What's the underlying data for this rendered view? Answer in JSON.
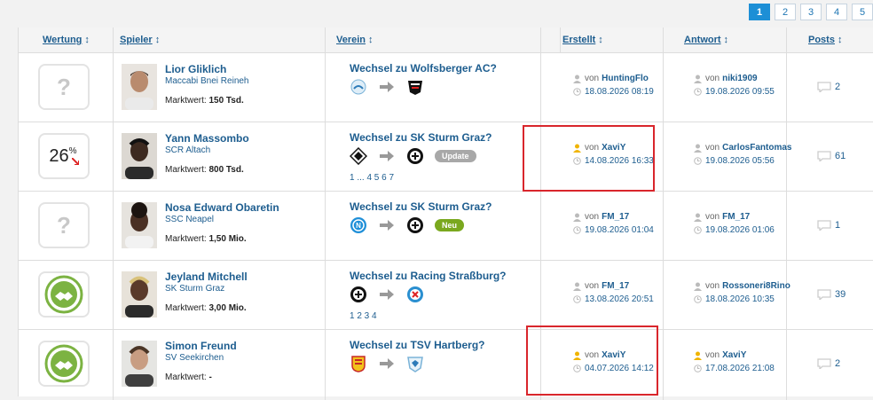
{
  "pagination": [
    "1",
    "2",
    "3",
    "4",
    "5"
  ],
  "headers": {
    "rating": "Wertung",
    "player": "Spieler",
    "club": "Verein",
    "created": "Erstellt",
    "answer": "Antwort",
    "posts": "Posts"
  },
  "rows": [
    {
      "rating": "?",
      "player": "Lior Gliklich",
      "player_club": "Maccabi Bnei Reineh",
      "value_label": "Marktwert:",
      "value": "150 Tsd.",
      "thread": "Wechsel zu Wolfsberger AC?",
      "created_by": "von",
      "created_user": "HuntingFlo",
      "created_time": "18.08.2026 08:19",
      "answer_by": "von",
      "answer_user": "niki1909",
      "answer_time": "19.08.2026 09:55",
      "posts": "2"
    },
    {
      "rating": "26",
      "player": "Yann Massombo",
      "player_club": "SCR Altach",
      "value_label": "Marktwert:",
      "value": "800 Tsd.",
      "thread": "Wechsel zu SK Sturm Graz?",
      "badge": "Update",
      "thread_pages": "1 ... 4 5 6 7",
      "created_by": "von",
      "created_user": "XaviY",
      "created_time": "14.08.2026 16:33",
      "answer_by": "von",
      "answer_user": "CarlosFantomas",
      "answer_time": "19.08.2026 05:56",
      "posts": "61"
    },
    {
      "rating": "?",
      "player": "Nosa Edward Obaretin",
      "player_club": "SSC Neapel",
      "value_label": "Marktwert:",
      "value": "1,50 Mio.",
      "thread": "Wechsel zu SK Sturm Graz?",
      "badge": "Neu",
      "created_by": "von",
      "created_user": "FM_17",
      "created_time": "19.08.2026 01:04",
      "answer_by": "von",
      "answer_user": "FM_17",
      "answer_time": "19.08.2026 01:06",
      "posts": "1"
    },
    {
      "rating": "",
      "player": "Jeyland Mitchell",
      "player_club": "SK Sturm Graz",
      "value_label": "Marktwert:",
      "value": "3,00 Mio.",
      "thread": "Wechsel zu Racing Straßburg?",
      "thread_pages": "1 2 3 4",
      "created_by": "von",
      "created_user": "FM_17",
      "created_time": "13.08.2026 20:51",
      "answer_by": "von",
      "answer_user": "Rossoneri8Rino",
      "answer_time": "18.08.2026 10:35",
      "posts": "39"
    },
    {
      "rating": "",
      "player": "Simon Freund",
      "player_club": "SV Seekirchen",
      "value_label": "Marktwert:",
      "value": "-",
      "thread": "Wechsel zu TSV Hartberg?",
      "created_by": "von",
      "created_user": "XaviY",
      "created_time": "04.07.2026 14:12",
      "answer_by": "von",
      "answer_user": "XaviY",
      "answer_time": "17.08.2026 21:08",
      "posts": "2"
    }
  ],
  "colors": {
    "link": "#1d5d8f",
    "active_page": "#1d8fd6",
    "badge_update": "#a8a8a8",
    "badge_new": "#7aa81e",
    "handshake": "#7cb342",
    "highlight": "#d9262c",
    "user_highlight": "#f0b400"
  },
  "icons": [
    "user-icon",
    "clock-icon",
    "comment-icon",
    "arrow-right-icon",
    "handshake-icon",
    "sort-icon"
  ]
}
